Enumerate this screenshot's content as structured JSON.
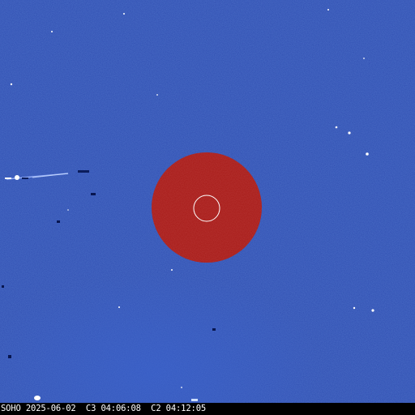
{
  "caption": {
    "observatory": "SOHO",
    "date": "2025-06-02",
    "c3_label": "C3",
    "c3_time": "04:06:08",
    "c2_label": "C2",
    "c2_time": "04:12:05"
  },
  "colors": {
    "background": "#1f3fa6",
    "occulter_disk": "#a31512",
    "sun_outline": "#ffffff",
    "caption_bar": "#000000",
    "caption_text": "#ffffff"
  }
}
